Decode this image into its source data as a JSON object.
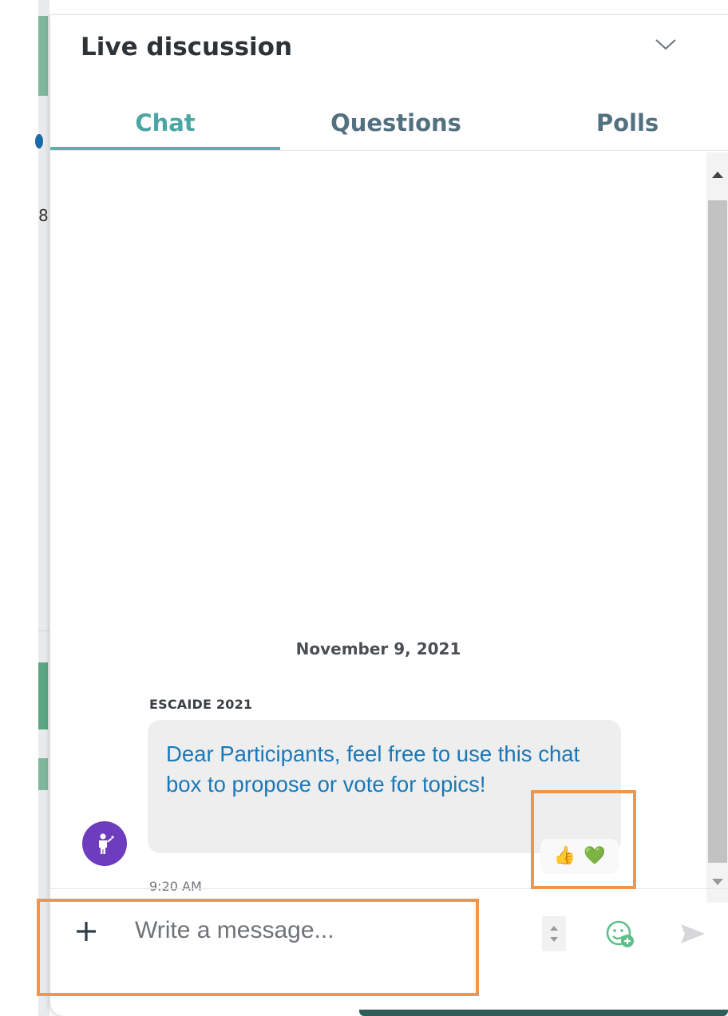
{
  "panel": {
    "title": "Live discussion",
    "collapse_icon": "chevron-down-icon"
  },
  "tabs": [
    {
      "label": "Chat",
      "active": true
    },
    {
      "label": "Questions",
      "active": false
    },
    {
      "label": "Polls",
      "active": false
    }
  ],
  "chat": {
    "date_separator": "November 9, 2021",
    "messages": [
      {
        "sender": "ESCAIDE 2021",
        "text": "Dear Participants, feel free to use this chat box to propose or vote for topics!",
        "time": "9:20 AM",
        "avatar_icon": "presenter-icon",
        "reactions": [
          "👍",
          "💚"
        ]
      }
    ]
  },
  "composer": {
    "placeholder": "Write a message...",
    "attach_icon": "plus-icon",
    "emoji_icon": "add-emoji-icon",
    "send_icon": "send-icon"
  },
  "colors": {
    "accent": "#59b2ad",
    "tab_text": "#53707f",
    "message_text": "#1a78b8",
    "avatar_bg": "#6e3dbf",
    "highlight": "#f0954a"
  },
  "behind_fragments": [
    "8"
  ]
}
